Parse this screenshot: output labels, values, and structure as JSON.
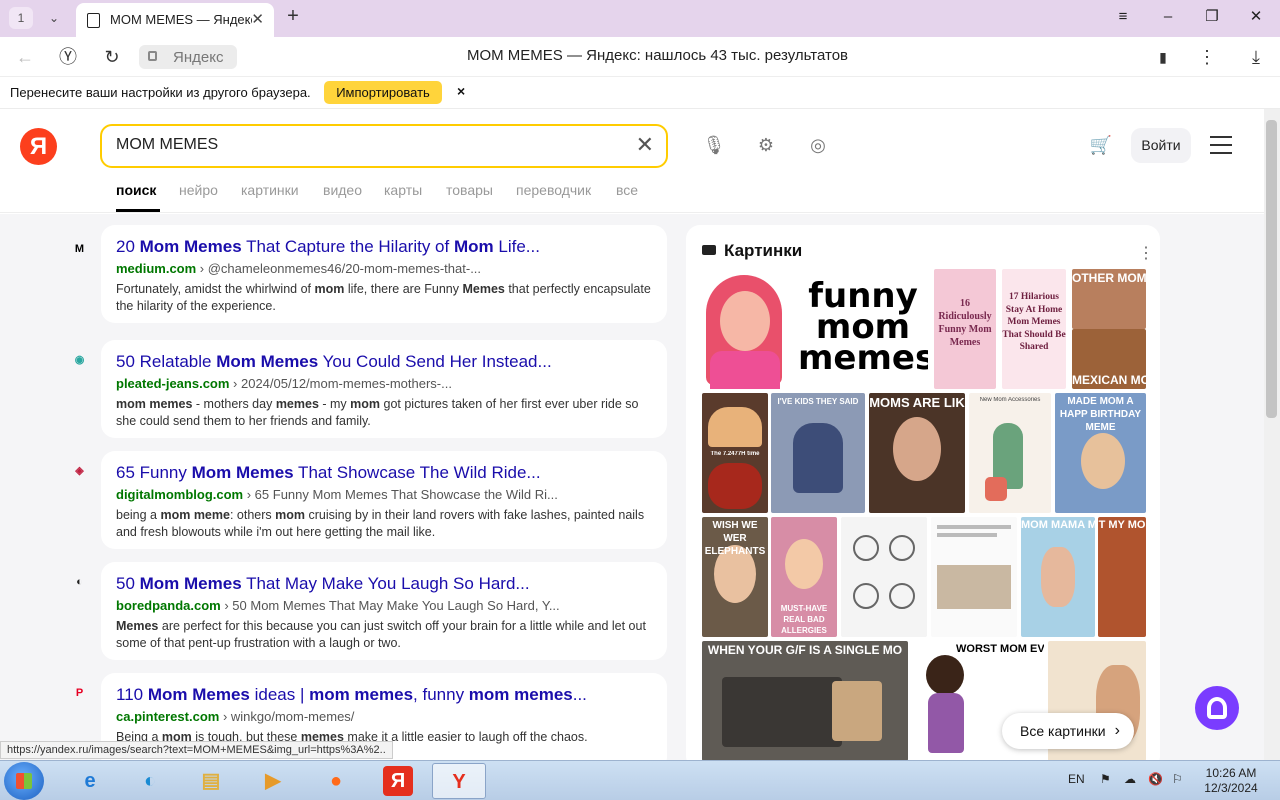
{
  "browser": {
    "tab_count": "1",
    "tab_title": "MOM MEMES — Яндекс",
    "address_chip": "Яндекс",
    "address_title": "MOM MEMES — Яндекс: нашлось 43 тыс. результатов",
    "status_url": "https://yandex.ru/images/search?text=MOM+MEMES&img_url=https%3A%2.."
  },
  "infobar": {
    "text": "Перенесите ваши настройки из другого браузера.",
    "import_label": "Импортировать",
    "close_glyph": "×"
  },
  "yandex": {
    "logo": "Я",
    "search_value": "MOM MEMES",
    "login_label": "Войти",
    "tabs": [
      {
        "label": "поиск"
      },
      {
        "label": "нейро"
      },
      {
        "label": "картинки"
      },
      {
        "label": "видео"
      },
      {
        "label": "карты"
      },
      {
        "label": "товары"
      },
      {
        "label": "переводчик"
      },
      {
        "label": "все"
      }
    ]
  },
  "results": [
    {
      "favicon": "M",
      "title_parts": [
        "20 ",
        "Mom Memes",
        " That Capture the Hilarity of ",
        "Mom",
        " Life..."
      ],
      "domain": "medium.com",
      "path": " › @chameleonmemes46/20-mom-memes-that-...",
      "snippet_parts": [
        "Fortunately, amidst the whirlwind of ",
        "mom",
        " life, there are Funny ",
        "Memes",
        " that perfectly encapsulate the hilarity of the experience."
      ]
    },
    {
      "favicon": "◉",
      "title_parts": [
        "50 Relatable ",
        "Mom Memes",
        " You Could Send Her Instead..."
      ],
      "domain": "pleated-jeans.com",
      "path": " › 2024/05/12/mom-memes-mothers-...",
      "snippet_parts": [
        "",
        "mom memes",
        " - mothers day ",
        "memes",
        " - my ",
        "mom",
        " got pictures taken of her first ever uber ride so she could send them to her friends and family."
      ]
    },
    {
      "favicon": "◈",
      "title_parts": [
        "65 Funny ",
        "Mom Memes",
        " That Showcase The Wild Ride..."
      ],
      "domain": "digitalmomblog.com",
      "path": " › 65 Funny Mom Memes That Showcase the Wild Ri...",
      "snippet_parts": [
        "being a ",
        "mom meme",
        ": others ",
        "mom",
        " cruising by in their land rovers with fake lashes, painted nails and fresh blowouts while i'm out here getting the mail like."
      ]
    },
    {
      "favicon": "◐",
      "title_parts": [
        "50 ",
        "Mom Memes",
        " That May Make You Laugh So Hard..."
      ],
      "domain": "boredpanda.com",
      "path": " › 50 Mom Memes That May Make You Laugh So Hard, Y...",
      "snippet_parts": [
        "",
        "Memes",
        " are perfect for this because you can just switch off your brain for a little while and let out some of that pent-up frustration with a laugh or two."
      ]
    },
    {
      "favicon": "P",
      "title_parts": [
        "110 ",
        "Mom Memes",
        " ideas | ",
        "mom memes",
        ", funny ",
        "mom memes",
        "..."
      ],
      "domain": "ca.pinterest.com",
      "path": " › winkgo/mom-memes/",
      "snippet_parts": [
        "Being a ",
        "mom",
        " is tough, but these ",
        "memes",
        " make it a little easier to laugh off the chaos."
      ]
    }
  ],
  "images_panel": {
    "heading": "Картинки",
    "all_images_label": "Все картинки",
    "thumbs": [
      {
        "caption": ""
      },
      {
        "caption": "funny mom memes"
      },
      {
        "caption": "16 Ridiculously Funny Mom Memes"
      },
      {
        "caption": "17 Hilarious Stay At Home Mom Memes That Should Be Shared"
      },
      {
        "caption": "OTHER MOM"
      },
      {
        "caption": "MEXICAN MO"
      },
      {
        "caption": "The 7.2477H time"
      },
      {
        "caption": "I'VE KIDS THEY SAID"
      },
      {
        "caption": "MOMS ARE LIK"
      },
      {
        "caption": "New Mom Accessories"
      },
      {
        "caption": "MADE MOM A HAPP BIRTHDAY MEME"
      },
      {
        "caption": "WISH WE WER ELEPHANTS"
      },
      {
        "caption": "MUST-HAVE REAL BAD ALLERGIES"
      },
      {
        "caption": ""
      },
      {
        "caption": ""
      },
      {
        "caption": "MOM MAMA M"
      },
      {
        "caption": "T MY MO"
      },
      {
        "caption": "WHEN YOUR G/F IS A SINGLE MO"
      },
      {
        "caption": "WORST MOM EVER"
      },
      {
        "caption": ""
      }
    ]
  },
  "taskbar": {
    "lang": "EN",
    "time": "10:26 AM",
    "date": "12/3/2024"
  }
}
